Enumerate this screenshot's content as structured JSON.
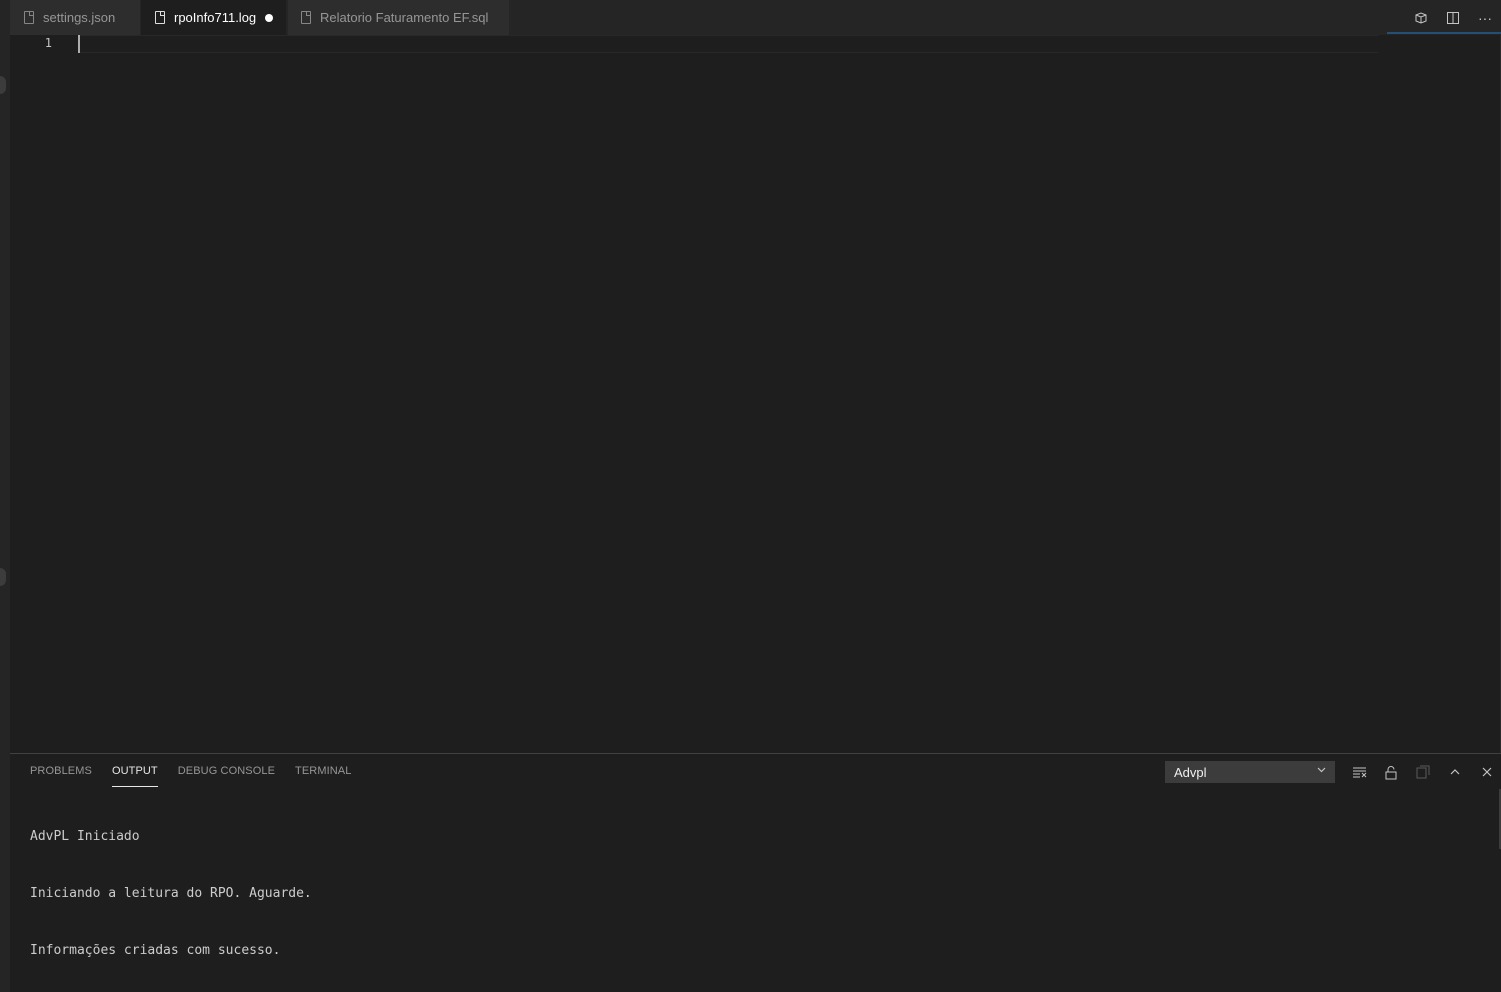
{
  "tabs": [
    {
      "label": "settings.json",
      "active": false,
      "dirty": false
    },
    {
      "label": "rpoInfo711.log",
      "active": true,
      "dirty": true
    },
    {
      "label": "Relatorio Faturamento EF.sql",
      "active": false,
      "dirty": false
    }
  ],
  "tab_actions": {
    "open_preview_icon": "open-changes-icon",
    "split_editor_icon": "split-editor-icon",
    "more_actions_label": "···"
  },
  "editor": {
    "line_numbers": [
      "1"
    ],
    "content": ""
  },
  "panel": {
    "tabs": [
      {
        "label": "PROBLEMS",
        "active": false
      },
      {
        "label": "OUTPUT",
        "active": true
      },
      {
        "label": "DEBUG CONSOLE",
        "active": false
      },
      {
        "label": "TERMINAL",
        "active": false
      }
    ],
    "output_channel": "Advpl",
    "output_lines": [
      "AdvPL Iniciado",
      "Iniciando a leitura do RPO. Aguarde.",
      "Informações criadas com sucesso."
    ]
  },
  "colors": {
    "background": "#1e1e1e",
    "tabbar": "#252526",
    "inactive_tab": "#2d2d2d",
    "accent": "#264f78"
  }
}
